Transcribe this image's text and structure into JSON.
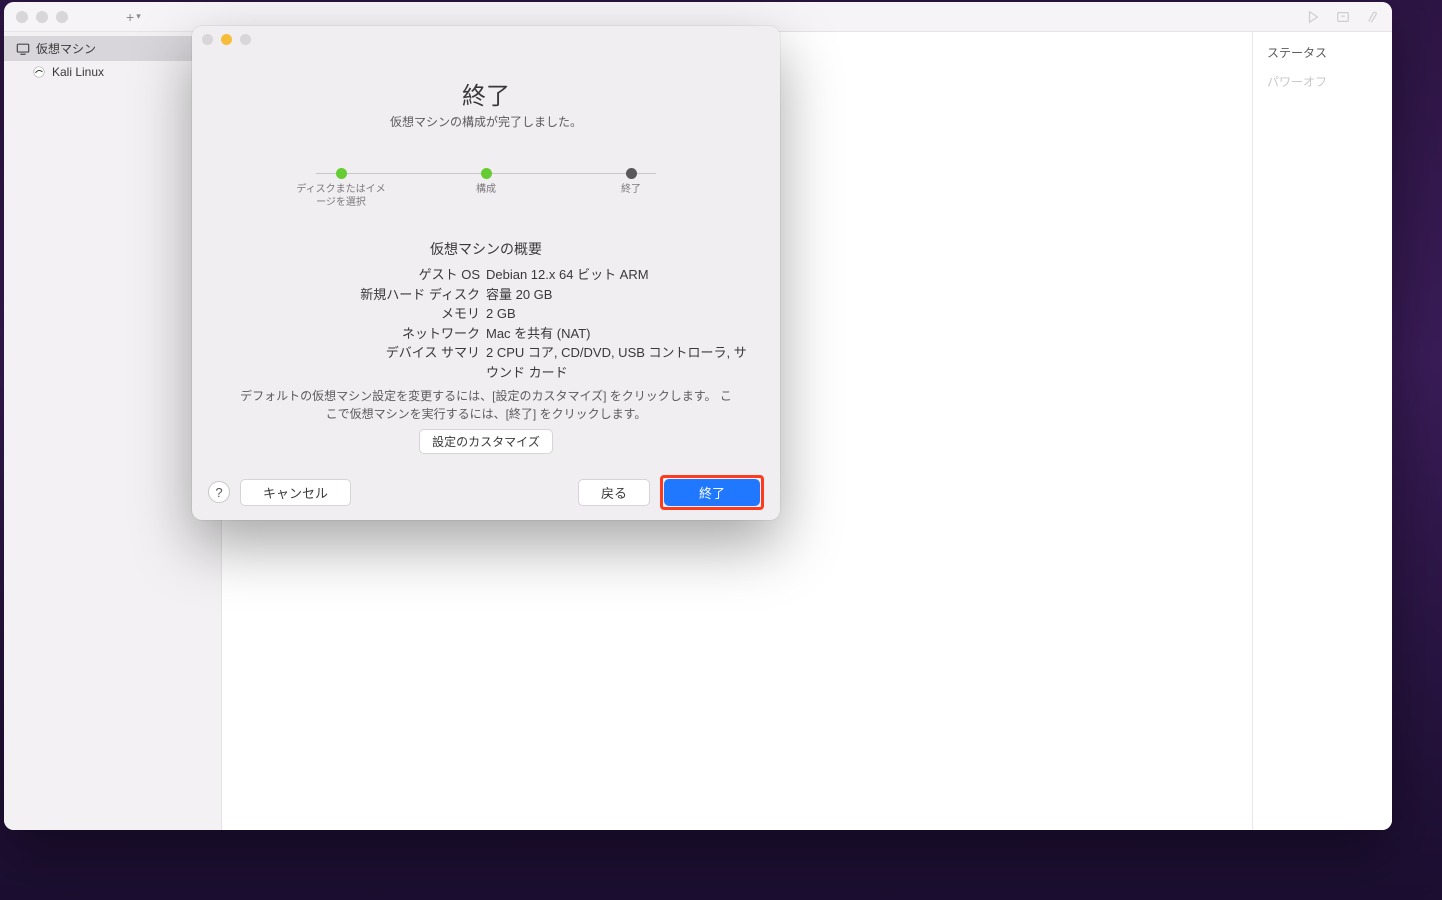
{
  "main_window": {
    "add_menu_label": "+",
    "right_pane": {
      "status_label": "ステータス",
      "status_value": "パワーオフ"
    }
  },
  "sidebar": {
    "group_label": "仮想マシン",
    "items": [
      {
        "label": "Kali Linux"
      }
    ]
  },
  "dialog": {
    "title": "終了",
    "subtitle": "仮想マシンの構成が完了しました。",
    "steps": [
      {
        "label": "ディスクまたはイメージを選択",
        "state": "done"
      },
      {
        "label": "構成",
        "state": "done"
      },
      {
        "label": "終了",
        "state": "current"
      }
    ],
    "summary": {
      "heading": "仮想マシンの概要",
      "rows": [
        {
          "k": "ゲスト OS",
          "v": "Debian 12.x 64 ビット ARM"
        },
        {
          "k": "新規ハード ディスク",
          "v": "容量 20 GB"
        },
        {
          "k": "メモリ",
          "v": "2 GB"
        },
        {
          "k": "ネットワーク",
          "v": "Mac を共有 (NAT)"
        },
        {
          "k": "デバイス サマリ",
          "v": "2 CPU コア, CD/DVD, USB コントローラ, サウンド カード"
        }
      ]
    },
    "hint": "デフォルトの仮想マシン設定を変更するには、[設定のカスタマイズ] をクリックします。 ここで仮想マシンを実行するには、[終了] をクリックします。",
    "customize_label": "設定のカスタマイズ",
    "footer": {
      "help": "?",
      "cancel": "キャンセル",
      "back": "戻る",
      "finish": "終了"
    }
  }
}
